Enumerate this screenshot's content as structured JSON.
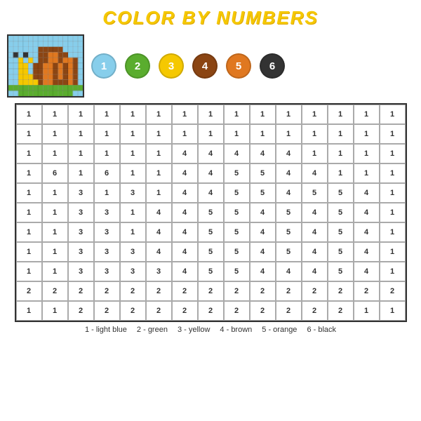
{
  "title": "COLOR BY NUMBERS",
  "colors": [
    {
      "number": 1,
      "label": "light blue",
      "hex": "#87CEEB"
    },
    {
      "number": 2,
      "label": "green",
      "hex": "#5aad2e"
    },
    {
      "number": 3,
      "label": "yellow",
      "hex": "#f5c800"
    },
    {
      "number": 4,
      "label": "brown",
      "hex": "#8B4513"
    },
    {
      "number": 5,
      "label": "orange",
      "hex": "#e07820"
    },
    {
      "number": 6,
      "label": "black",
      "hex": "#333333"
    }
  ],
  "legend": "1 - light blue   2 - green   3 - yellow   4 - brown   5 - orange   6 - black",
  "legendItems": [
    "1 - light blue",
    "2 - green",
    "3 - yellow",
    "4 - brown",
    "5 - orange",
    "6 - black"
  ],
  "grid": [
    [
      1,
      1,
      1,
      1,
      1,
      1,
      1,
      1,
      1,
      1,
      1,
      1,
      1,
      1,
      1
    ],
    [
      1,
      1,
      1,
      1,
      1,
      1,
      1,
      1,
      1,
      1,
      1,
      1,
      1,
      1,
      1
    ],
    [
      1,
      1,
      1,
      1,
      1,
      1,
      4,
      4,
      4,
      4,
      4,
      1,
      1,
      1,
      1
    ],
    [
      1,
      6,
      1,
      6,
      1,
      1,
      4,
      4,
      5,
      5,
      4,
      4,
      1,
      1,
      1
    ],
    [
      1,
      1,
      3,
      1,
      3,
      1,
      4,
      4,
      5,
      5,
      4,
      5,
      5,
      4,
      1
    ],
    [
      1,
      1,
      3,
      3,
      1,
      4,
      4,
      5,
      5,
      4,
      5,
      4,
      5,
      4,
      1
    ],
    [
      1,
      1,
      3,
      3,
      1,
      4,
      4,
      5,
      5,
      4,
      5,
      4,
      5,
      4,
      1
    ],
    [
      1,
      1,
      3,
      3,
      3,
      4,
      4,
      5,
      5,
      4,
      5,
      4,
      5,
      4,
      1
    ],
    [
      1,
      1,
      3,
      3,
      3,
      3,
      4,
      5,
      5,
      4,
      4,
      4,
      5,
      4,
      1
    ],
    [
      2,
      2,
      2,
      2,
      2,
      2,
      2,
      2,
      2,
      2,
      2,
      2,
      2,
      2,
      2
    ],
    [
      1,
      1,
      2,
      2,
      2,
      2,
      2,
      2,
      2,
      2,
      2,
      2,
      2,
      1,
      1
    ]
  ]
}
